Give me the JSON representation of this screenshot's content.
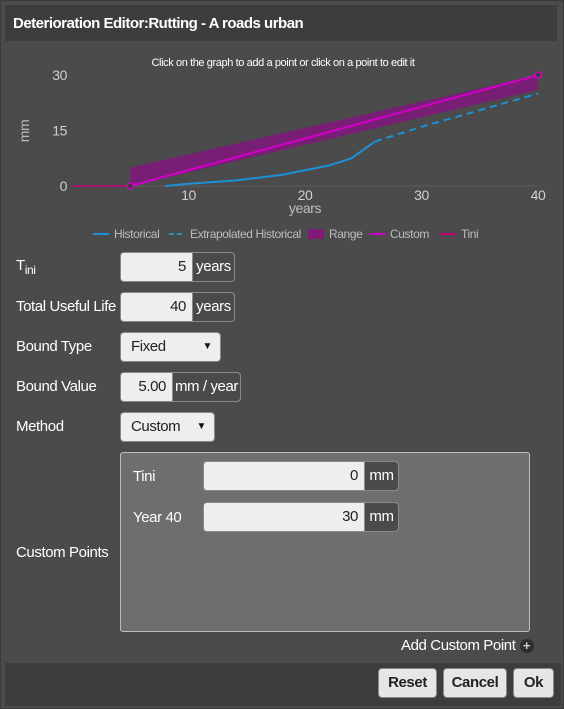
{
  "dialog": {
    "title": "Deterioration Editor:Rutting - A roads urban"
  },
  "chart_data": {
    "type": "line",
    "hint": "Click on the graph to add a point or click on a point to edit it",
    "xlabel": "years",
    "ylabel": "mm",
    "xlim": [
      0,
      40
    ],
    "ylim": [
      0,
      30
    ],
    "x_ticks": [
      "10",
      "20",
      "30",
      "40"
    ],
    "y_ticks": [
      "30",
      "15",
      "0"
    ],
    "grid": false,
    "legend_position": "bottom",
    "legend": [
      "Historical",
      "Extrapolated Historical",
      "Range",
      "Custom",
      "Tini"
    ],
    "colors": {
      "historical": "#1e90d6",
      "extrapolated": "#1e90d6",
      "range": "#7d1a78",
      "custom": "#d000c8",
      "tini": "#c0007a"
    },
    "series": [
      {
        "name": "Historical",
        "x": [
          8,
          10,
          14,
          18,
          22,
          24,
          26
        ],
        "y": [
          0,
          0.6,
          1.5,
          3,
          5.5,
          7.5,
          12
        ]
      },
      {
        "name": "Extrapolated Historical",
        "x": [
          26,
          30,
          35,
          40
        ],
        "y": [
          12,
          16,
          20.5,
          25
        ]
      },
      {
        "name": "Custom",
        "x": [
          5,
          40
        ],
        "y": [
          0,
          30
        ]
      },
      {
        "name": "Tini",
        "x": [
          0,
          5
        ],
        "y": [
          0,
          0
        ]
      }
    ],
    "range_band": {
      "x": [
        5,
        40
      ],
      "upper": [
        5,
        30
      ],
      "lower": [
        0,
        26
      ]
    }
  },
  "fields": {
    "tini": {
      "label_main": "T",
      "label_sub": "ini",
      "value": "5",
      "unit": "years"
    },
    "total_useful_life": {
      "label": "Total Useful Life",
      "value": "40",
      "unit": "years"
    },
    "bound_type": {
      "label": "Bound Type",
      "value": "Fixed"
    },
    "bound_value": {
      "label": "Bound Value",
      "value": "5.00",
      "unit": "mm / year"
    },
    "method": {
      "label": "Method",
      "value": "Custom"
    }
  },
  "custom_points": {
    "label": "Custom Points",
    "rows": [
      {
        "label": "Tini",
        "value": "0",
        "unit": "mm"
      },
      {
        "label": "Year 40",
        "value": "30",
        "unit": "mm"
      }
    ],
    "add_label": "Add Custom Point"
  },
  "buttons": {
    "reset": "Reset",
    "cancel": "Cancel",
    "ok": "Ok"
  }
}
